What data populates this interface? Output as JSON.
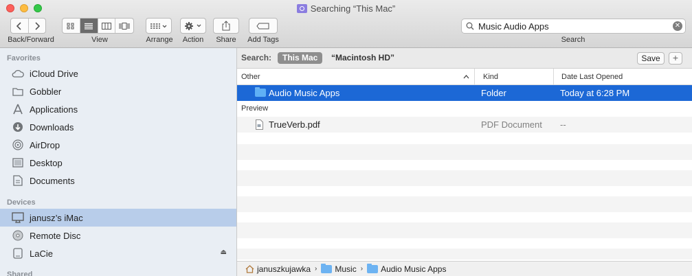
{
  "window": {
    "title": "Searching “This Mac”"
  },
  "toolbar": {
    "back_forward_label": "Back/Forward",
    "view_label": "View",
    "arrange_label": "Arrange",
    "action_label": "Action",
    "share_label": "Share",
    "add_tags_label": "Add Tags",
    "search_label": "Search",
    "search_value": "Music Audio Apps"
  },
  "sidebar": {
    "favorites_header": "Favorites",
    "favorites": [
      {
        "label": "iCloud Drive",
        "icon": "cloud-icon"
      },
      {
        "label": "Gobbler",
        "icon": "folder-icon"
      },
      {
        "label": "Applications",
        "icon": "applications-icon"
      },
      {
        "label": "Downloads",
        "icon": "downloads-icon"
      },
      {
        "label": "AirDrop",
        "icon": "airdrop-icon"
      },
      {
        "label": "Desktop",
        "icon": "desktop-icon"
      },
      {
        "label": "Documents",
        "icon": "documents-icon"
      }
    ],
    "devices_header": "Devices",
    "devices": [
      {
        "label": "janusz’s iMac",
        "icon": "imac-icon",
        "selected": true
      },
      {
        "label": "Remote Disc",
        "icon": "disc-icon"
      },
      {
        "label": "LaCie",
        "icon": "drive-icon",
        "eject": true
      }
    ],
    "shared_header": "Shared"
  },
  "scope": {
    "label": "Search:",
    "this_mac": "This Mac",
    "macintosh_hd": "“Macintosh HD”",
    "save": "Save",
    "plus": "+"
  },
  "columns": {
    "name": "Other",
    "kind": "Kind",
    "date": "Date Last Opened"
  },
  "results": {
    "other": [
      {
        "name": "Audio Music Apps",
        "kind": "Folder",
        "date": "Today at 6:28 PM",
        "selected": true
      }
    ],
    "preview_header": "Preview",
    "preview": [
      {
        "name": "TrueVerb.pdf",
        "kind": "PDF Document",
        "date": "--"
      }
    ]
  },
  "pathbar": [
    {
      "label": "januszkujawka",
      "icon": "home-icon"
    },
    {
      "label": "Music",
      "icon": "music-folder-icon"
    },
    {
      "label": "Audio Music Apps",
      "icon": "folder-icon"
    }
  ],
  "colors": {
    "selection": "#1c68d6",
    "sidebar_bg": "#e9eef4",
    "sidebar_selected": "#b8cdea"
  }
}
